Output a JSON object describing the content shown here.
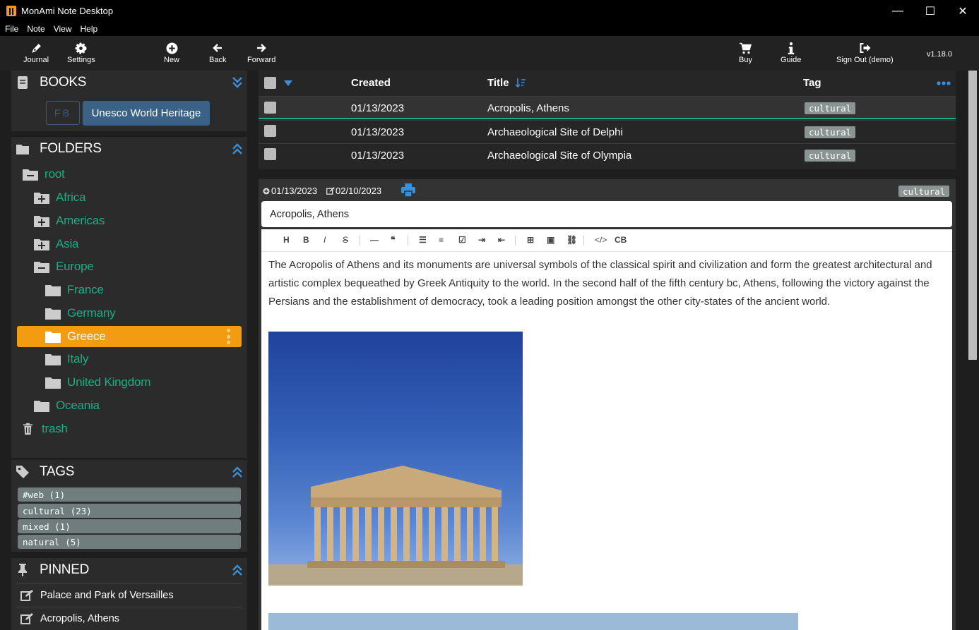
{
  "window": {
    "title": "MonAmi Note Desktop",
    "controls": [
      "—",
      "☐",
      "✕"
    ]
  },
  "menu": [
    "File",
    "Note",
    "View",
    "Help"
  ],
  "toolbar": {
    "journal": "Journal",
    "settings": "Settings",
    "new": "New",
    "back": "Back",
    "forward": "Forward",
    "buy": "Buy",
    "guide": "Guide",
    "signout": "Sign Out (demo)",
    "version": "v1.18.0"
  },
  "books": {
    "title": "BOOKS",
    "fb": "FB",
    "current": "Unesco World Heritage"
  },
  "folders": {
    "title": "FOLDERS",
    "items": [
      "root",
      "Africa",
      "Americas",
      "Asia",
      "Europe",
      "France",
      "Germany",
      "Greece",
      "Italy",
      "United Kingdom",
      "Oceania",
      "trash"
    ]
  },
  "tags": {
    "title": "TAGS",
    "items": [
      "#web (1)",
      "cultural (23)",
      "mixed (1)",
      "natural (5)"
    ]
  },
  "pinned": {
    "title": "PINNED",
    "items": [
      "Palace and Park of Versailles",
      "Acropolis, Athens"
    ]
  },
  "table": {
    "headers": {
      "created": "Created",
      "title": "Title",
      "tag": "Tag"
    },
    "rows": [
      {
        "created": "01/13/2023",
        "title": "Acropolis, Athens",
        "tag": "cultural"
      },
      {
        "created": "01/13/2023",
        "title": "Archaeological Site of Delphi",
        "tag": "cultural"
      },
      {
        "created": "01/13/2023",
        "title": "Archaeological Site of Olympia",
        "tag": "cultural"
      }
    ]
  },
  "note": {
    "created": "01/13/2023",
    "modified": "02/10/2023",
    "tag": "cultural",
    "title": "Acropolis, Athens",
    "body": "The Acropolis of Athens and its monuments are universal symbols of the classical spirit and civilization and form the greatest architectural and artistic complex bequeathed by Greek Antiquity to the world. In the second half of the fifth century bc, Athens, following the victory against the Persians and the establishment of democracy, took a leading position amongst the other city-states of the ancient world.",
    "editor_tools": [
      "H",
      "B",
      "I",
      "S",
      "—",
      "❝",
      "☰",
      "≡",
      "☑",
      "⇥",
      "⇤",
      "⊞",
      "▣",
      "⛓",
      "</>",
      "CB"
    ]
  }
}
